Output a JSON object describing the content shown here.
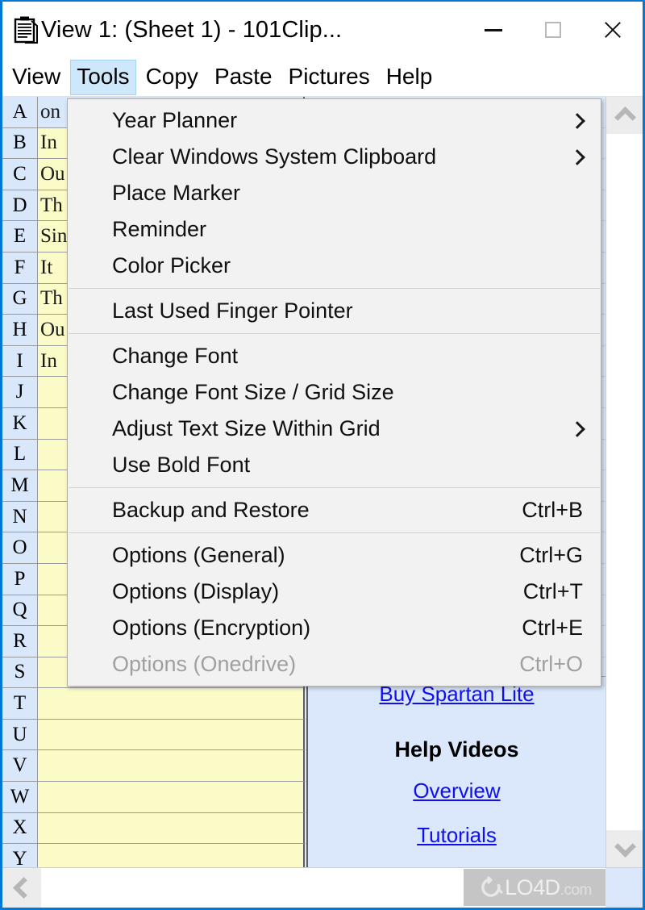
{
  "window": {
    "icon": "clipboard-icon",
    "title": "View 1:  (Sheet 1)  -  101Clip...",
    "controls": {
      "minimize": "minimize-icon",
      "maximize": "maximize-icon",
      "close": "close-icon"
    }
  },
  "menubar": {
    "items": [
      {
        "label": "View",
        "active": false
      },
      {
        "label": "Tools",
        "active": true
      },
      {
        "label": "Copy",
        "active": false
      },
      {
        "label": "Paste",
        "active": false
      },
      {
        "label": "Pictures",
        "active": false
      },
      {
        "label": "Help",
        "active": false
      }
    ]
  },
  "tools_menu": {
    "items": [
      {
        "label": "Year Planner",
        "accel": "",
        "submenu": true,
        "disabled": false
      },
      {
        "label": "Clear Windows System Clipboard",
        "accel": "",
        "submenu": true,
        "disabled": false
      },
      {
        "label": "Place Marker",
        "accel": "",
        "submenu": false,
        "disabled": false
      },
      {
        "label": "Reminder",
        "accel": "",
        "submenu": false,
        "disabled": false
      },
      {
        "label": "Color Picker",
        "accel": "",
        "submenu": false,
        "disabled": false
      },
      {
        "separator": true
      },
      {
        "label": "Last Used Finger Pointer",
        "accel": "",
        "submenu": false,
        "disabled": false
      },
      {
        "separator": true
      },
      {
        "label": "Change Font",
        "accel": "",
        "submenu": false,
        "disabled": false
      },
      {
        "label": "Change Font Size / Grid Size",
        "accel": "",
        "submenu": false,
        "disabled": false
      },
      {
        "label": "Adjust Text Size Within Grid",
        "accel": "",
        "submenu": true,
        "disabled": false
      },
      {
        "label": "Use Bold Font",
        "accel": "",
        "submenu": false,
        "disabled": false
      },
      {
        "separator": true
      },
      {
        "label": "Backup and Restore",
        "accel": "Ctrl+B",
        "submenu": false,
        "disabled": false
      },
      {
        "separator": true
      },
      {
        "label": "Options (General)",
        "accel": "Ctrl+G",
        "submenu": false,
        "disabled": false
      },
      {
        "label": "Options (Display)",
        "accel": "Ctrl+T",
        "submenu": false,
        "disabled": false
      },
      {
        "label": "Options (Encryption)",
        "accel": "Ctrl+E",
        "submenu": false,
        "disabled": false
      },
      {
        "label": "Options (Onedrive)",
        "accel": "Ctrl+O",
        "submenu": false,
        "disabled": true
      }
    ]
  },
  "grid": {
    "rows": [
      {
        "header": "A",
        "text": "on",
        "selected": true
      },
      {
        "header": "B",
        "text": "In",
        "selected": false
      },
      {
        "header": "C",
        "text": "Ou",
        "selected": false
      },
      {
        "header": "D",
        "text": "Th",
        "selected": false
      },
      {
        "header": "E",
        "text": "Sin",
        "selected": false
      },
      {
        "header": "F",
        "text": "It ",
        "selected": false
      },
      {
        "header": "G",
        "text": "Th",
        "selected": false
      },
      {
        "header": "H",
        "text": "Ou",
        "selected": false
      },
      {
        "header": "I",
        "text": "In",
        "selected": false
      },
      {
        "header": "J",
        "text": "",
        "selected": false
      },
      {
        "header": "K",
        "text": "",
        "selected": false
      },
      {
        "header": "L",
        "text": "",
        "selected": false
      },
      {
        "header": "M",
        "text": "",
        "selected": false
      },
      {
        "header": "N",
        "text": "",
        "selected": false
      },
      {
        "header": "O",
        "text": "",
        "selected": false
      },
      {
        "header": "P",
        "text": "",
        "selected": false
      },
      {
        "header": "Q",
        "text": "",
        "selected": false
      },
      {
        "header": "R",
        "text": "",
        "selected": false
      },
      {
        "header": "S",
        "text": "",
        "selected": false
      },
      {
        "header": "T",
        "text": "",
        "selected": false
      },
      {
        "header": "U",
        "text": "",
        "selected": false
      },
      {
        "header": "V",
        "text": "",
        "selected": false
      },
      {
        "header": "W",
        "text": "",
        "selected": false
      },
      {
        "header": "X",
        "text": "",
        "selected": false
      },
      {
        "header": "Y",
        "text": "",
        "selected": false
      }
    ]
  },
  "info_panel": {
    "buy_link": "Buy Spartan Lite",
    "help_videos_title": "Help Videos",
    "overview_link": "Overview",
    "tutorials_link": "Tutorials"
  },
  "scrollbars": {
    "v_up": "chevron-up-icon",
    "v_down": "chevron-down-icon",
    "h_left": "chevron-left-icon"
  },
  "watermark": {
    "brand": "LO4D",
    "domain": ".com"
  },
  "colors": {
    "window_border": "#0078d7",
    "cell_yellow": "#fbfbc8",
    "header_blue": "#d9e7fb",
    "panel_blue": "#dbe8fb",
    "link_blue": "#1010ee",
    "menu_bg": "#f2f2f2",
    "menubar_active": "#cde8fa"
  }
}
